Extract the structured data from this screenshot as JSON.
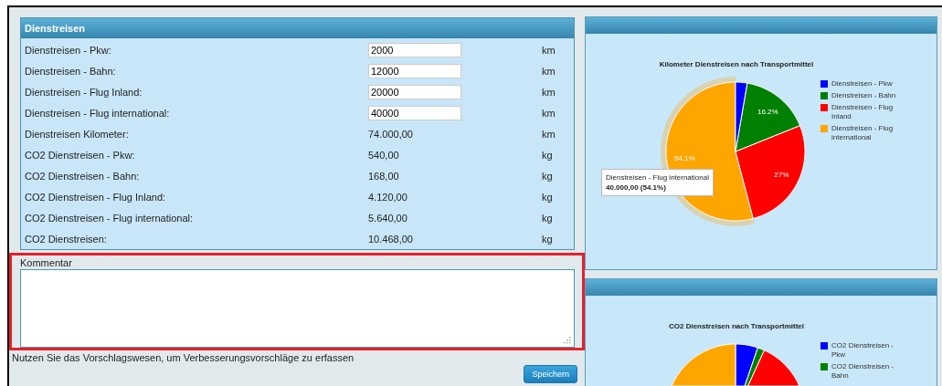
{
  "left_panel": {
    "title": "Dienstreisen",
    "rows": [
      {
        "kind": "input",
        "label": "Dienstreisen - Pkw:",
        "value": "2000",
        "unit": "km"
      },
      {
        "kind": "input",
        "label": "Dienstreisen - Bahn:",
        "value": "12000",
        "unit": "km"
      },
      {
        "kind": "input",
        "label": "Dienstreisen - Flug Inland:",
        "value": "20000",
        "unit": "km"
      },
      {
        "kind": "input",
        "label": "Dienstreisen - Flug international:",
        "value": "40000",
        "unit": "km"
      },
      {
        "kind": "output",
        "label": "Dienstreisen Kilometer:",
        "value": "74.000,00",
        "unit": "km"
      },
      {
        "kind": "output",
        "label": "CO2 Dienstreisen - Pkw:",
        "value": "540,00",
        "unit": "kg"
      },
      {
        "kind": "output",
        "label": "CO2 Dienstreisen - Bahn:",
        "value": "168,00",
        "unit": "kg"
      },
      {
        "kind": "output",
        "label": "CO2 Dienstreisen - Flug Inland:",
        "value": "4.120,00",
        "unit": "kg"
      },
      {
        "kind": "output",
        "label": "CO2 Dienstreisen - Flug international:",
        "value": "5.640,00",
        "unit": "kg"
      },
      {
        "kind": "output",
        "label": "CO2 Dienstreisen:",
        "value": "10.468,00",
        "unit": "kg"
      }
    ]
  },
  "comment": {
    "label": "Kommentar",
    "highlighted": true
  },
  "hint": "Nutzen Sie das Vorschlagswesen, um Verbesserungsvorschläge zu erfassen",
  "save_button": "Speichern",
  "charts": [
    {
      "chart_data": {
        "type": "pie",
        "title": "Kilometer Dienstreisen nach Transportmittel",
        "legend": "right",
        "categories": [
          "Dienstreisen - Pkw",
          "Dienstreisen - Bahn",
          "Dienstreisen - Flug Inland",
          "Dienstreisen - Flug international"
        ],
        "colors": [
          "#0000ff",
          "#008000",
          "#ff0000",
          "#ffa500"
        ],
        "values": [
          2.7,
          16.2,
          27,
          54.1
        ],
        "value_labels": [
          null,
          "16.2%",
          "27%",
          "54.1%"
        ]
      },
      "hovered": [
        false,
        false,
        false,
        true
      ],
      "tooltip": {
        "title": "Dienstreisen - Flug international",
        "value": "40.000,00 (54.1%)"
      }
    },
    {
      "kind": "picture",
      "title": "CO2 Dienstreisen nach Transportmittel",
      "legend": [
        {
          "label": "CO2 Dienstreisen - Pkw",
          "color": "#0000ff"
        },
        {
          "label": "CO2 Dienstreisen - Bahn",
          "color": "#008000"
        }
      ]
    }
  ]
}
